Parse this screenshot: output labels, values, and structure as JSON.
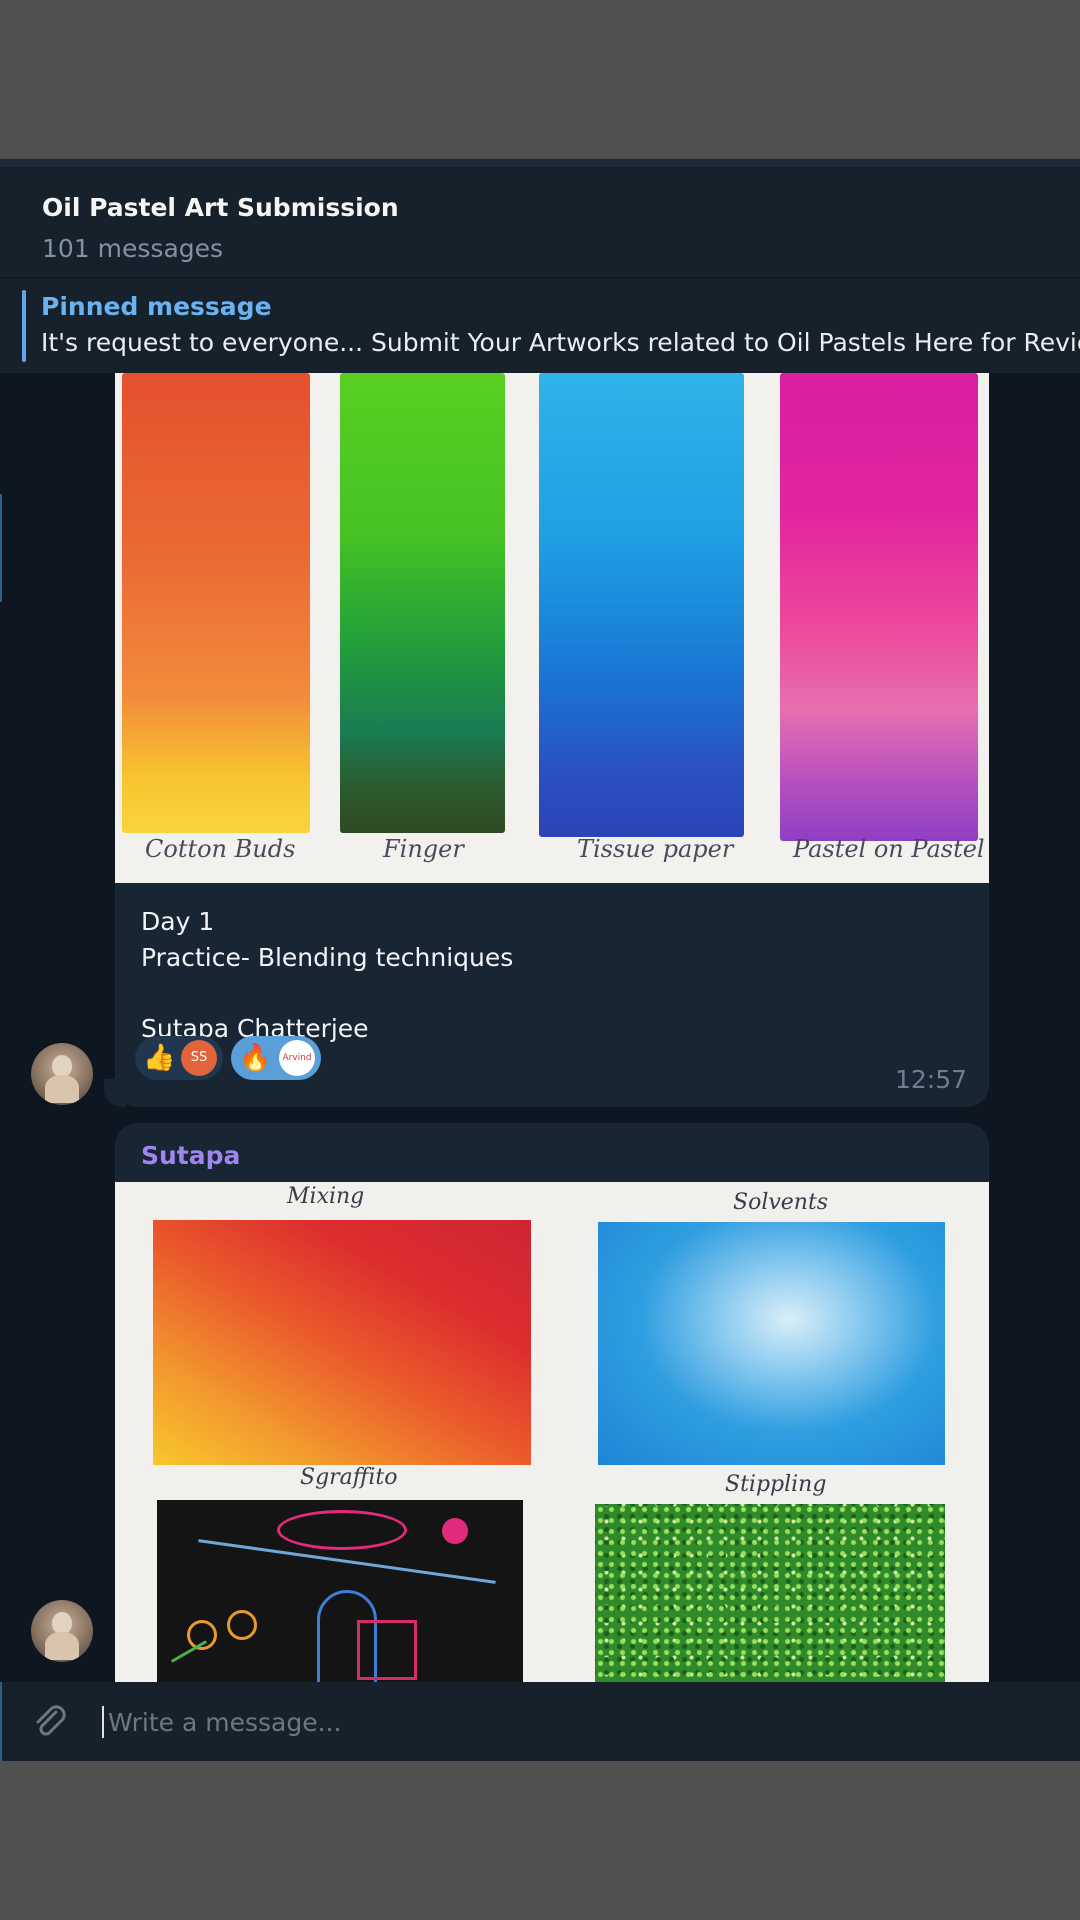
{
  "chat": {
    "title": "Oil Pastel Art Submission",
    "subtitle": "101 messages"
  },
  "pinned": {
    "label": "Pinned message",
    "text": "It's request to everyone... Submit Your Artworks related to Oil Pastels Here for Review"
  },
  "messages": [
    {
      "photo_labels": [
        "Cotton Buds",
        "Finger",
        "Tissue paper",
        "Pastel on Pastel"
      ],
      "caption_lines": [
        "Day 1",
        "Practice- Blending techniques",
        "Sutapa Chatterjee"
      ],
      "reactions": [
        {
          "emoji": "👍",
          "avatar_text": "SS",
          "avatar_color": "#e0653a"
        },
        {
          "emoji": "🔥",
          "avatar_text": "Arvind",
          "avatar_color": "#ffffff"
        }
      ],
      "time": "12:57",
      "avatar_icon": "buddha-avatar-icon"
    },
    {
      "sender": "Sutapa",
      "photo_labels": [
        "Mixing",
        "Solvents",
        "Sgraffito",
        "Stippling"
      ],
      "avatar_icon": "buddha-avatar-icon"
    }
  ],
  "composer": {
    "placeholder": "Write a message...",
    "attach_icon": "paperclip-icon"
  },
  "colors": {
    "background": "#0e1621",
    "header": "#17212b",
    "bubble": "#182533",
    "accent": "#6ab3f3",
    "sender_name": "#9e85f0"
  }
}
